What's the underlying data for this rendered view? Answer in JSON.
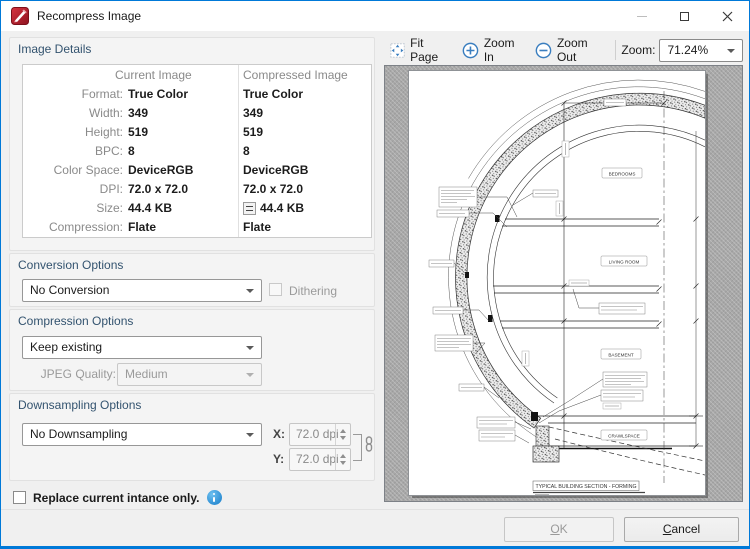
{
  "window": {
    "title": "Recompress Image"
  },
  "image_details": {
    "group_label": "Image Details",
    "columns": {
      "current": "Current Image",
      "compressed": "Compressed Image"
    },
    "rows": [
      {
        "label": "Format:",
        "current": "True Color",
        "compressed": "True Color"
      },
      {
        "label": "Width:",
        "current": "349",
        "compressed": "349"
      },
      {
        "label": "Height:",
        "current": "519",
        "compressed": "519"
      },
      {
        "label": "BPC:",
        "current": "8",
        "compressed": "8"
      },
      {
        "label": "Color Space:",
        "current": "DeviceRGB",
        "compressed": "DeviceRGB"
      },
      {
        "label": "DPI:",
        "current": "72.0 x 72.0",
        "compressed": "72.0 x 72.0"
      },
      {
        "label": "Size:",
        "current": "44.4 KB",
        "compressed": "44.4 KB"
      },
      {
        "label": "Compression:",
        "current": "Flate",
        "compressed": "Flate"
      }
    ]
  },
  "conversion": {
    "group_label": "Conversion Options",
    "dropdown_value": "No Conversion",
    "dithering_label": "Dithering"
  },
  "compression": {
    "group_label": "Compression Options",
    "dropdown_value": "Keep existing",
    "jpeg_quality_label": "JPEG Quality:",
    "jpeg_quality_value": "Medium"
  },
  "downsampling": {
    "group_label": "Downsampling Options",
    "dropdown_value": "No Downsampling",
    "x_label": "X:",
    "x_value": "72.0 dpi",
    "y_label": "Y:",
    "y_value": "72.0 dpi"
  },
  "replace_checkbox_label": "Replace current intance only.",
  "preview": {
    "toolbar": {
      "fit_page": "Fit Page",
      "zoom_in": "Zoom In",
      "zoom_out": "Zoom Out",
      "zoom_label": "Zoom:",
      "zoom_value": "71.24%"
    },
    "drawing": {
      "rooms": [
        "BEDROOMS",
        "LIVING ROOM",
        "BASEMENT",
        "CRAWLSPACE"
      ],
      "title": "TYPICAL BUILDING SECTION - FORMING"
    }
  },
  "footer": {
    "ok": "OK",
    "cancel": "Cancel"
  },
  "colors": {
    "accent_blue": "#0079d8",
    "app_icon_red": "#b01f2b",
    "group_header": "#33536f",
    "toolbar_icon_blue": "#3a7ebf",
    "info_icon_blue": "#2f8fd4"
  }
}
